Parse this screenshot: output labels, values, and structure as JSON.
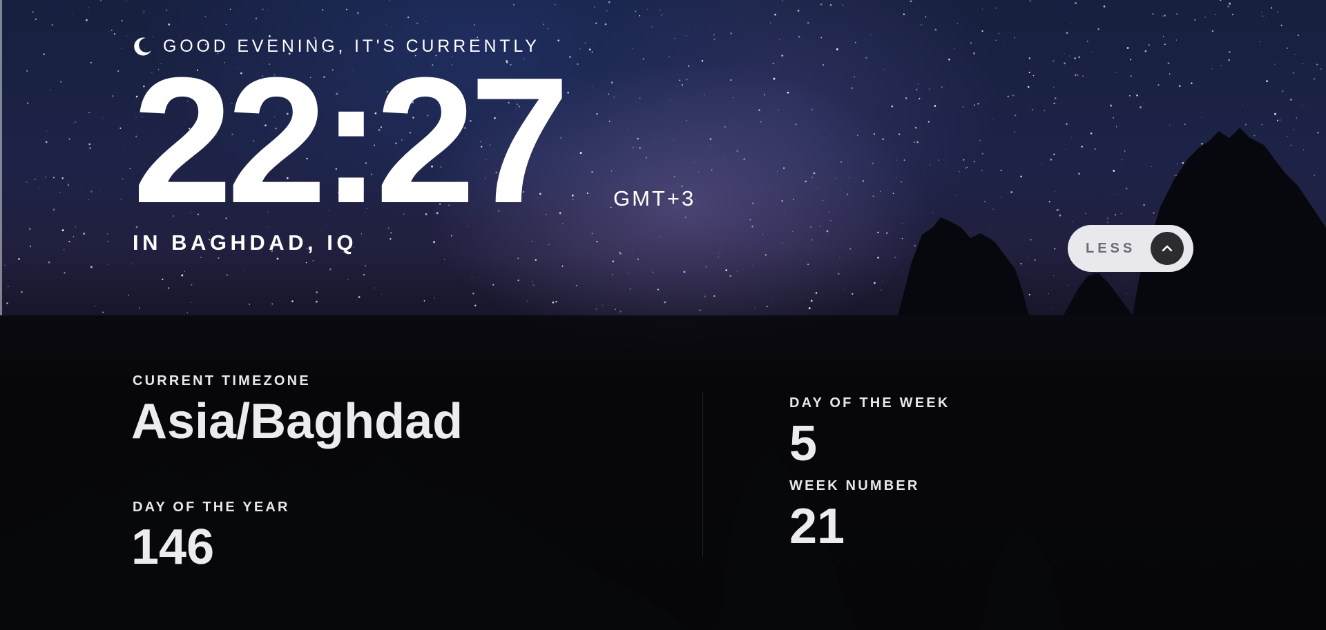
{
  "header": {
    "greeting": "GOOD EVENING, IT'S CURRENTLY",
    "greeting_icon": "moon-icon",
    "time": "22:27",
    "timezone_abbr": "GMT+3",
    "location": "IN BAGHDAD, IQ"
  },
  "toggle": {
    "label": "LESS",
    "icon": "chevron-up-icon"
  },
  "details": {
    "timezone_label": "CURRENT TIMEZONE",
    "timezone_value": "Asia/Baghdad",
    "day_of_year_label": "DAY OF THE YEAR",
    "day_of_year_value": "146",
    "day_of_week_label": "DAY OF THE WEEK",
    "day_of_week_value": "5",
    "week_number_label": "WEEK NUMBER",
    "week_number_value": "21"
  },
  "colors": {
    "button_bg": "#e9e8ec",
    "button_circle": "#2b2b30",
    "panel_bg": "#060609"
  }
}
